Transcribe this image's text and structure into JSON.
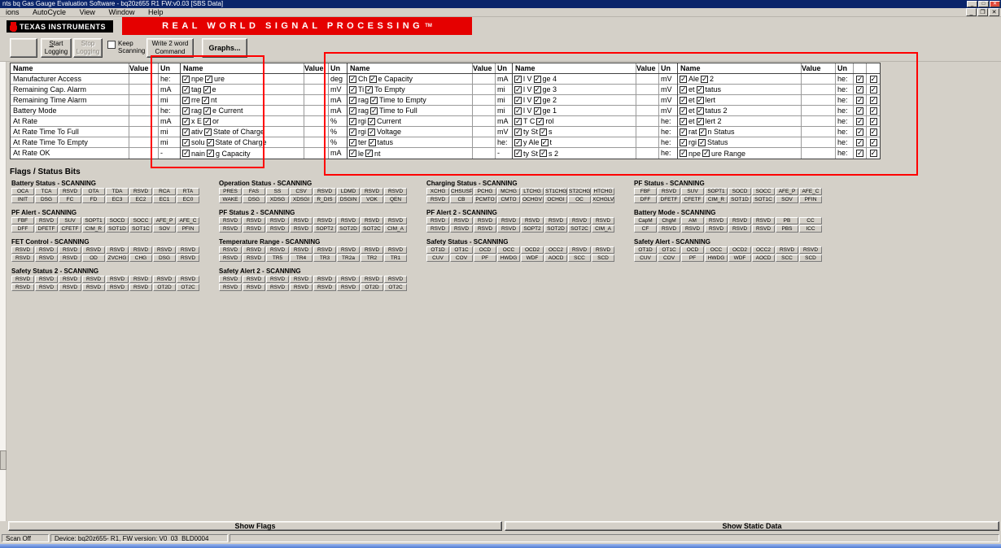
{
  "icons": {
    "minimize": "_",
    "maximize": "□",
    "close": "✕",
    "restore": "❐",
    "check": "✓"
  },
  "titlebar": {
    "title": "nts bq Gas Gauge Evaluation Software - bq20z655 R1 FW:v0.03   [SBS Data]"
  },
  "menubar": {
    "items": [
      "ions",
      "AutoCycle",
      "View",
      "Window",
      "Help"
    ]
  },
  "brand": {
    "logo": "Texas Instruments",
    "banner": "Real World Signal Processing",
    "tm": "TM"
  },
  "toolbar": {
    "start": {
      "l1": "Start",
      "l2": "Logging"
    },
    "stop": {
      "l1": "Stop",
      "l2": "Logging"
    },
    "keep": {
      "l1": "Keep",
      "l2": "Scanning"
    },
    "write": {
      "l1": "Write 2 word",
      "l2": "Command"
    },
    "graphs": "Graphs..."
  },
  "sbs": {
    "headers": {
      "name": "Name",
      "value": "Value",
      "unit": "Un"
    },
    "t1": {
      "rows": [
        {
          "name": "Manufacturer Access",
          "value": "",
          "unit": "he:"
        },
        {
          "name": "Remaining Cap. Alarm",
          "value": "",
          "unit": "mA"
        },
        {
          "name": "Remaining Time Alarm",
          "value": "",
          "unit": "mi"
        },
        {
          "name": "Battery Mode",
          "value": "",
          "unit": "he:"
        },
        {
          "name": "At Rate",
          "value": "",
          "unit": "mA"
        },
        {
          "name": "At Rate Time To Full",
          "value": "",
          "unit": "mi"
        },
        {
          "name": "At Rate Time To Empty",
          "value": "",
          "unit": "mi"
        },
        {
          "name": "At Rate OK",
          "value": "",
          "unit": "-"
        }
      ]
    },
    "t2": {
      "rows": [
        {
          "f1": "npe",
          "f2": "ure",
          "value": "",
          "unit": "deg"
        },
        {
          "f1": "tag",
          "f2": "e",
          "value": "",
          "unit": "mV"
        },
        {
          "f1": "rre",
          "f2": "nt",
          "value": "",
          "unit": "mA"
        },
        {
          "f1": "rag",
          "f2": "e Current",
          "value": "",
          "unit": "mA"
        },
        {
          "f1": "x E",
          "f2": "or",
          "value": "",
          "unit": "%"
        },
        {
          "f1": "ativ",
          "f2": "State of Charge",
          "value": "",
          "unit": "%"
        },
        {
          "f1": "solu",
          "f2": "State of Charge",
          "value": "",
          "unit": "%"
        },
        {
          "f1": "nain",
          "f2": "g Capacity",
          "value": "",
          "unit": "mA"
        }
      ]
    },
    "t3": {
      "rows": [
        {
          "f1": "Ch",
          "f2": "e Capacity",
          "value": "",
          "unit": "mA"
        },
        {
          "f1": "Ti",
          "f2": "To Empty",
          "value": "",
          "unit": "mi"
        },
        {
          "f1": "rag",
          "f2": "Time to Empty",
          "value": "",
          "unit": "mi"
        },
        {
          "f1": "rag",
          "f2": "Time to Full",
          "value": "",
          "unit": "mi"
        },
        {
          "f1": "rgi",
          "f2": "Current",
          "value": "",
          "unit": "mA"
        },
        {
          "f1": "rgi",
          "f2": "Voltage",
          "value": "",
          "unit": "mV"
        },
        {
          "f1": "ter",
          "f2": "tatus",
          "value": "",
          "unit": "he:"
        },
        {
          "f1": "le",
          "f2": "nt",
          "value": "",
          "unit": "-"
        }
      ]
    },
    "t4": {
      "rows": [
        {
          "f1": "l V",
          "f2": "ge 4",
          "value": "",
          "unit": "mV"
        },
        {
          "f1": "l V",
          "f2": "ge 3",
          "value": "",
          "unit": "mV"
        },
        {
          "f1": "l V",
          "f2": "ge 2",
          "value": "",
          "unit": "mV"
        },
        {
          "f1": "l V",
          "f2": "ge 1",
          "value": "",
          "unit": "mV"
        },
        {
          "f1": "T C",
          "f2": "rol",
          "value": "",
          "unit": "he:"
        },
        {
          "f1": "ty St",
          "f2": "s",
          "value": "",
          "unit": "he:"
        },
        {
          "f1": "y Ale",
          "f2": "t",
          "value": "",
          "unit": "he:"
        },
        {
          "f1": "ty St",
          "f2": "s 2",
          "value": "",
          "unit": "he:"
        }
      ]
    },
    "t5": {
      "rows": [
        {
          "f1": "Ale",
          "f2": "2",
          "value": "",
          "unit": "he:"
        },
        {
          "f1": "et",
          "f2": "tatus",
          "value": "",
          "unit": "he:"
        },
        {
          "f1": "et",
          "f2": "lert",
          "value": "",
          "unit": "he:"
        },
        {
          "f1": "et",
          "f2": "tatus 2",
          "value": "",
          "unit": "he:"
        },
        {
          "f1": "et",
          "f2": "lert 2",
          "value": "",
          "unit": "he:"
        },
        {
          "f1": "rat",
          "f2": "n Status",
          "value": "",
          "unit": "he:"
        },
        {
          "f1": "rgi",
          "f2": "Status",
          "value": "",
          "unit": "he:"
        },
        {
          "f1": "npe",
          "f2": "ure Range",
          "value": "",
          "unit": "he:"
        }
      ]
    }
  },
  "flags": {
    "section_title": "Flags / Status Bits",
    "groups": [
      {
        "title": "Battery Status - SCANNING",
        "rows": [
          [
            "OCA",
            "TCA",
            "RSVD",
            "OTA",
            "TDA",
            "RSVD",
            "RCA",
            "RTA"
          ],
          [
            "INIT",
            "DSG",
            "FC",
            "FD",
            "EC3",
            "EC2",
            "EC1",
            "EC0"
          ]
        ]
      },
      {
        "title": "Operation Status - SCANNING",
        "rows": [
          [
            "PRES",
            "FAS",
            "SS",
            "CSV",
            "RSVD",
            "LDMD",
            "RSVD",
            "RSVD"
          ],
          [
            "WAKE",
            "DSG",
            "XDSG",
            "XDSGI",
            "R_DIS",
            "DSGIN",
            "VOK",
            "QEN"
          ]
        ]
      },
      {
        "title": "Charging Status - SCANNING",
        "rows": [
          [
            "XCHG",
            "CHSUSP",
            "PCHG",
            "MCHG",
            "LTCHG",
            "ST1CHG",
            "ST2CHG",
            "HTCHG"
          ],
          [
            "RSVD",
            "CB",
            "PCMTO",
            "CMTO",
            "OCHGV",
            "OCHGI",
            "OC",
            "XCHGLV"
          ]
        ]
      },
      {
        "title": "PF Status - SCANNING",
        "rows": [
          [
            "FBF",
            "RSVD",
            "SUV",
            "SOPT1",
            "SOCD",
            "SOCC",
            "AFE_P",
            "AFE_C"
          ],
          [
            "DFF",
            "DFETF",
            "CFETF",
            "CIM_R",
            "SOT1D",
            "SOT1C",
            "SOV",
            "PFIN"
          ]
        ]
      },
      {
        "title": "PF Alert - SCANNING",
        "rows": [
          [
            "FBF",
            "RSVD",
            "SUV",
            "SOPT1",
            "SOCD",
            "SOCC",
            "AFE_P",
            "AFE_C"
          ],
          [
            "DFF",
            "DFETF",
            "CFETF",
            "CIM_R",
            "SOT1D",
            "SOT1C",
            "SOV",
            "PFIN"
          ]
        ]
      },
      {
        "title": "PF Status 2 - SCANNING",
        "rows": [
          [
            "RSVD",
            "RSVD",
            "RSVD",
            "RSVD",
            "RSVD",
            "RSVD",
            "RSVD",
            "RSVD"
          ],
          [
            "RSVD",
            "RSVD",
            "RSVD",
            "RSVD",
            "SOPT2",
            "SOT2D",
            "SOT2C",
            "CIM_A"
          ]
        ]
      },
      {
        "title": "PF Alert 2 - SCANNING",
        "rows": [
          [
            "RSVD",
            "RSVD",
            "RSVD",
            "RSVD",
            "RSVD",
            "RSVD",
            "RSVD",
            "RSVD"
          ],
          [
            "RSVD",
            "RSVD",
            "RSVD",
            "RSVD",
            "SOPT2",
            "SOT2D",
            "SOT2C",
            "CIM_A"
          ]
        ]
      },
      {
        "title": "Battery Mode - SCANNING",
        "rows": [
          [
            "CapM",
            "ChgM",
            "AM",
            "RSVD",
            "RSVD",
            "RSVD",
            "PB",
            "CC"
          ],
          [
            "CF",
            "RSVD",
            "RSVD",
            "RSVD",
            "RSVD",
            "RSVD",
            "PBS",
            "ICC"
          ]
        ]
      },
      {
        "title": "FET Control - SCANNING",
        "rows": [
          [
            "RSVD",
            "RSVD",
            "RSVD",
            "RSVD",
            "RSVD",
            "RSVD",
            "RSVD",
            "RSVD"
          ],
          [
            "RSVD",
            "RSVD",
            "RSVD",
            "OD",
            "ZVCHG",
            "CHG",
            "DSG",
            "RSVD"
          ]
        ]
      },
      {
        "title": "Temperature Range - SCANNING",
        "rows": [
          [
            "RSVD",
            "RSVD",
            "RSVD",
            "RSVD",
            "RSVD",
            "RSVD",
            "RSVD",
            "RSVD"
          ],
          [
            "RSVD",
            "RSVD",
            "TR5",
            "TR4",
            "TR3",
            "TR2a",
            "TR2",
            "TR1"
          ]
        ]
      },
      {
        "title": "Safety Status - SCANNING",
        "rows": [
          [
            "OT1D",
            "OT1C",
            "OCD",
            "OCC",
            "OCD2",
            "OCC2",
            "RSVD",
            "RSVD"
          ],
          [
            "CUV",
            "COV",
            "PF",
            "HWDG",
            "WDF",
            "AOCD",
            "SCC",
            "SCD"
          ]
        ]
      },
      {
        "title": "Safety Alert - SCANNING",
        "rows": [
          [
            "OT1D",
            "OT1C",
            "OCD",
            "OCC",
            "OCD2",
            "OCC2",
            "RSVD",
            "RSVD"
          ],
          [
            "CUV",
            "COV",
            "PF",
            "HWDG",
            "WDF",
            "AOCD",
            "SCC",
            "SCD"
          ]
        ]
      },
      {
        "title": "Safety Status 2 - SCANNING",
        "rows": [
          [
            "RSVD",
            "RSVD",
            "RSVD",
            "RSVD",
            "RSVD",
            "RSVD",
            "RSVD",
            "RSVD"
          ],
          [
            "RSVD",
            "RSVD",
            "RSVD",
            "RSVD",
            "RSVD",
            "RSVD",
            "OT2D",
            "OT2C"
          ]
        ]
      },
      {
        "title": "Safety Alert 2 - SCANNING",
        "rows": [
          [
            "RSVD",
            "RSVD",
            "RSVD",
            "RSVD",
            "RSVD",
            "RSVD",
            "RSVD",
            "RSVD"
          ],
          [
            "RSVD",
            "RSVD",
            "RSVD",
            "RSVD",
            "RSVD",
            "RSVD",
            "OT2D",
            "OT2C"
          ]
        ]
      }
    ]
  },
  "footer": {
    "show_flags": "Show Flags",
    "show_static": "Show Static Data"
  },
  "statusbar": {
    "scan": "Scan Off",
    "device": "Device: bq20z655- R1, FW version: V0_03_BLD0004"
  }
}
